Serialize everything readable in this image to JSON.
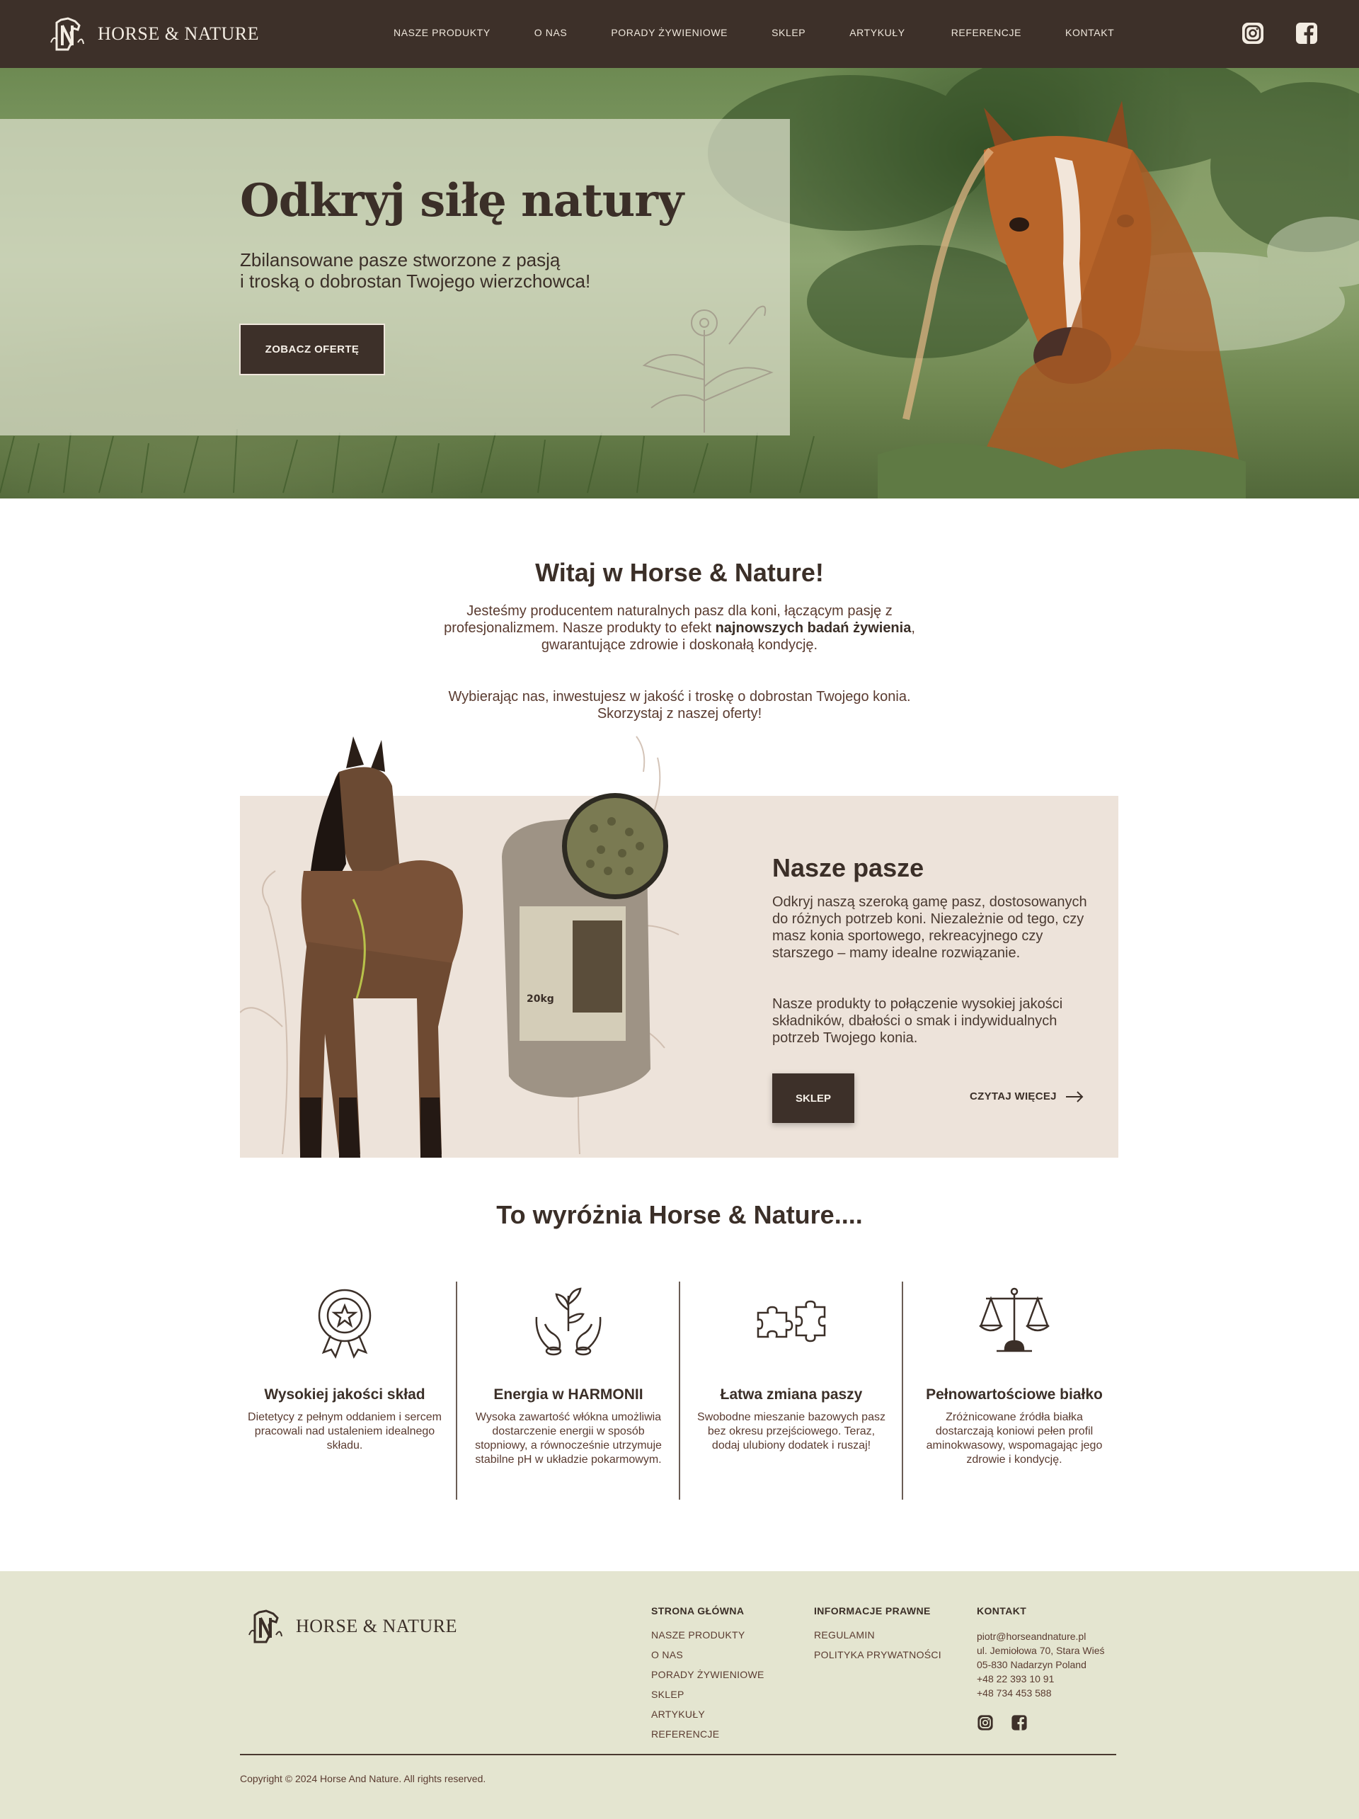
{
  "header": {
    "brand": "HORSE & NATURE",
    "nav": [
      "NASZE PRODUKTY",
      "O NAS",
      "PORADY ŻYWIENIOWE",
      "SKLEP",
      "ARTYKUŁY",
      "REFERENCJE",
      "KONTAKT"
    ]
  },
  "hero": {
    "title": "Odkryj siłę natury",
    "subtitle_line1": "Zbilansowane pasze stworzone z pasją",
    "subtitle_line2": "i troską o dobrostan Twojego wierzchowca!",
    "cta": "ZOBACZ OFERTĘ"
  },
  "welcome": {
    "title": "Witaj w Horse & Nature!",
    "p1_a": "Jesteśmy producentem naturalnych pasz dla koni, łączącym pasję z profesjonalizmem. Nasze produkty to efekt ",
    "p1_bold": "najnowszych badań żywienia",
    "p1_b": ", gwarantujące zdrowie i doskonałą kondycję.",
    "p2": "Wybierając nas, inwestujesz w jakość i troskę o dobrostan Twojego konia. Skorzystaj z naszej oferty!"
  },
  "feeds": {
    "title": "Nasze pasze",
    "p1": "Odkryj naszą szeroką gamę pasz, dostosowanych do różnych potrzeb koni. Niezależnie od tego, czy masz konia sportowego, rekreacyjnego czy starszego – mamy idealne rozwiązanie.",
    "p2": "Nasze produkty to połączenie wysokiej jakości składników, dbałości o smak i indywidualnych potrzeb Twojego konia.",
    "bag_weight": "20kg",
    "shop_button": "SKLEP",
    "read_more": "CZYTAJ WIĘCEJ"
  },
  "features": {
    "title": "To wyróżnia Horse & Nature....",
    "items": [
      {
        "icon": "award-badge-icon",
        "title": "Wysokiej jakości skład",
        "text": "Dietetycy z pełnym oddaniem i sercem pracowali nad ustaleniem idealnego składu."
      },
      {
        "icon": "hands-plant-icon",
        "title": "Energia w HARMONII",
        "text": "Wysoka zawartość włókna umożliwia dostarczenie energii w sposób stopniowy, a równocześnie utrzymuje stabilne pH w układzie pokarmowym."
      },
      {
        "icon": "puzzle-icon",
        "title": "Łatwa zmiana paszy",
        "text": "Swobodne mieszanie bazowych pasz bez okresu przejściowego. Teraz, dodaj ulubiony dodatek i ruszaj!"
      },
      {
        "icon": "scales-icon",
        "title": "Pełnowartościowe białko",
        "text": "Zróżnicowane źródła białka dostarczają koniowi pełen profil aminokwasowy, wspomagając jego zdrowie i kondycję."
      }
    ]
  },
  "footer": {
    "brand": "HORSE & NATURE",
    "col1_title": "STRONA GŁÓWNA",
    "col1_links": [
      "NASZE PRODUKTY",
      "O NAS",
      "PORADY ŻYWIENIOWE",
      "SKLEP",
      "ARTYKUŁY",
      "REFERENCJE"
    ],
    "col2_title": "INFORMACJE PRAWNE",
    "col2_links": [
      "REGULAMIN",
      "POLITYKA PRYWATNOŚCI"
    ],
    "col3_title": "KONTAKT",
    "contact": [
      "piotr@horseandnature.pl",
      "ul. Jemiołowa 70, Stara Wieś",
      "05-830 Nadarzyn Poland",
      "+48 22 393 10 91",
      "+48 734 453 588"
    ],
    "copyright": "Copyright © 2024 Horse And Nature. All rights reserved."
  },
  "colors": {
    "header_bg": "#3d3029",
    "text_dark": "#3b2f28",
    "feed_box_bg": "#ede3da",
    "footer_bg": "#e4e5d0"
  }
}
